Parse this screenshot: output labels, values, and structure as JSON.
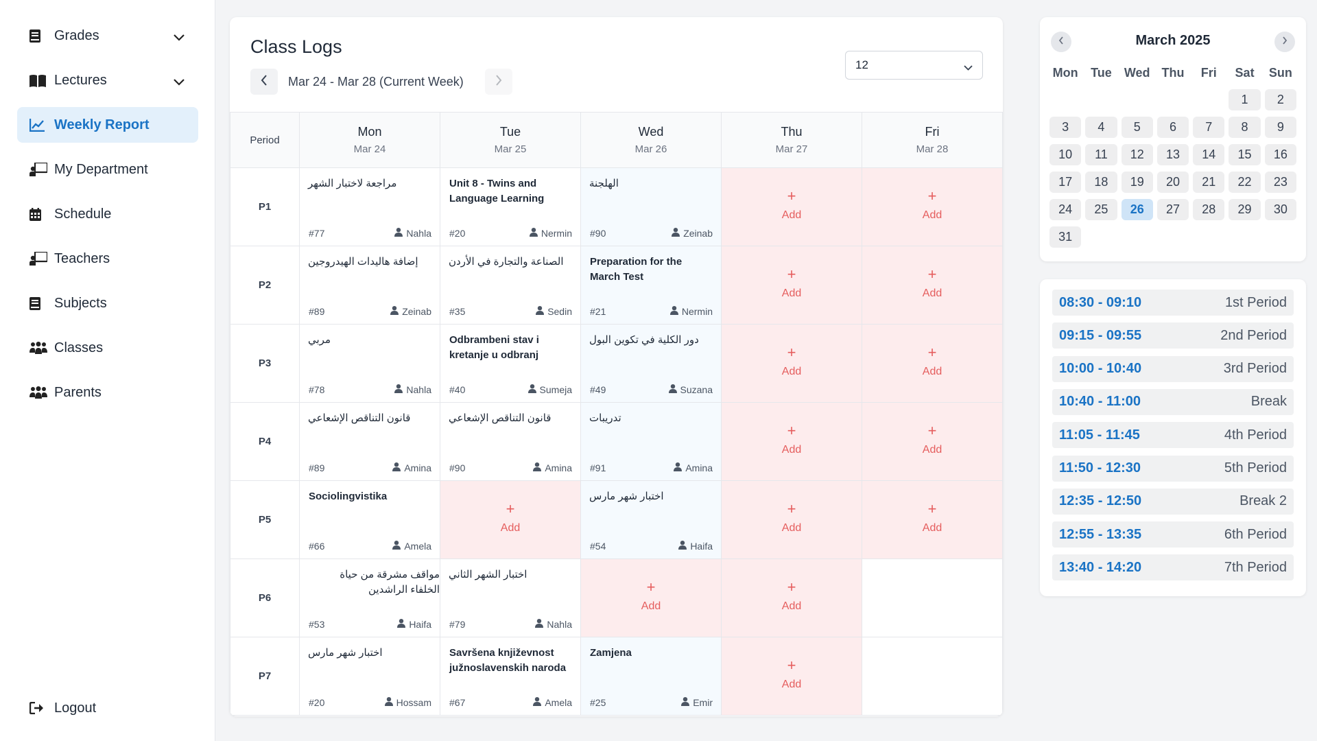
{
  "sidebar": {
    "items": [
      {
        "label": "Grades",
        "icon": "book-icon"
      },
      {
        "label": "Lectures",
        "icon": "open-book-icon"
      },
      {
        "label": "Weekly Report",
        "icon": "chart-line-icon"
      },
      {
        "label": "My Department",
        "icon": "chalkboard-teacher-icon"
      },
      {
        "label": "Schedule",
        "icon": "calendar-icon"
      },
      {
        "label": "Teachers",
        "icon": "chalkboard-teacher-icon"
      },
      {
        "label": "Subjects",
        "icon": "book-icon"
      },
      {
        "label": "Classes",
        "icon": "users-icon"
      },
      {
        "label": "Parents",
        "icon": "users-icon"
      }
    ],
    "logout": "Logout"
  },
  "main": {
    "title": "Class Logs",
    "week_label": "Mar 24 - Mar 28 (Current Week)",
    "class_select": "12",
    "period_header": "Period",
    "add_label": "Add",
    "add_plus": "+",
    "days": [
      {
        "name": "Mon",
        "date": "Mar 24"
      },
      {
        "name": "Tue",
        "date": "Mar 25"
      },
      {
        "name": "Wed",
        "date": "Mar 26"
      },
      {
        "name": "Thu",
        "date": "Mar 27"
      },
      {
        "name": "Fri",
        "date": "Mar 28"
      }
    ],
    "rows": [
      {
        "period": "P1",
        "cells": [
          {
            "topic": "مراجعة لاختبار الشهر",
            "num": "#77",
            "teacher": "Nahla"
          },
          {
            "topic": "Unit 8 - Twins and Language Learning",
            "num": "#20",
            "teacher": "Nermin"
          },
          {
            "topic": "الهلجنة",
            "num": "#90",
            "teacher": "Zeinab"
          }
        ]
      },
      {
        "period": "P2",
        "cells": [
          {
            "topic": "إضافة هاليدات الهيدروجين",
            "num": "#89",
            "teacher": "Zeinab"
          },
          {
            "topic": "الصناعة والتجارة في الأردن",
            "num": "#35",
            "teacher": "Sedin"
          },
          {
            "topic": "Preparation for the March Test",
            "num": "#21",
            "teacher": "Nermin"
          }
        ]
      },
      {
        "period": "P3",
        "cells": [
          {
            "topic": "مربي",
            "num": "#78",
            "teacher": "Nahla"
          },
          {
            "topic": "Odbrambeni stav i kretanje u odbranj",
            "num": "#40",
            "teacher": "Sumeja"
          },
          {
            "topic": "دور الكلية في تكوين البول",
            "num": "#49",
            "teacher": "Suzana"
          }
        ]
      },
      {
        "period": "P4",
        "cells": [
          {
            "topic": "قانون التناقص الإشعاعي",
            "num": "#89",
            "teacher": "Amina"
          },
          {
            "topic": "قانون التناقص الإشعاعي",
            "num": "#90",
            "teacher": "Amina"
          },
          {
            "topic": "تدريبات",
            "num": "#91",
            "teacher": "Amina"
          }
        ]
      },
      {
        "period": "P5",
        "cells": [
          {
            "topic": "Sociolingvistika",
            "num": "#66",
            "teacher": "Amela"
          },
          {
            "topic": "اختبار شهر مارس",
            "num": "#54",
            "teacher": "Haifa"
          }
        ]
      },
      {
        "period": "P6",
        "cells": [
          {
            "topic": "مواقف مشرقة من حياة الخلفاء الراشدين",
            "num": "#53",
            "teacher": "Haifa"
          },
          {
            "topic": "اختبار الشهر الثاني",
            "num": "#79",
            "teacher": "Nahla"
          }
        ]
      },
      {
        "period": "P7",
        "cells": [
          {
            "topic": "اختبار شهر مارس",
            "num": "#20",
            "teacher": "Hossam"
          },
          {
            "topic": "Savršena književnost južnoslavenskih naroda",
            "num": "#67",
            "teacher": "Amela"
          },
          {
            "topic": "Zamjena",
            "num": "#25",
            "teacher": "Emir"
          }
        ]
      }
    ]
  },
  "calendar": {
    "title": "March 2025",
    "weekdays": [
      "Mon",
      "Tue",
      "Wed",
      "Thu",
      "Fri",
      "Sat",
      "Sun"
    ],
    "leading_blanks": 5,
    "days_in_month": 31,
    "today": 26
  },
  "timetable": [
    {
      "time": "08:30 - 09:10",
      "name": "1st Period"
    },
    {
      "time": "09:15 - 09:55",
      "name": "2nd Period"
    },
    {
      "time": "10:00 - 10:40",
      "name": "3rd Period"
    },
    {
      "time": "10:40 - 11:00",
      "name": "Break"
    },
    {
      "time": "11:05 - 11:45",
      "name": "4th Period"
    },
    {
      "time": "11:50 - 12:30",
      "name": "5th Period"
    },
    {
      "time": "12:35 - 12:50",
      "name": "Break 2"
    },
    {
      "time": "12:55 - 13:35",
      "name": "6th Period"
    },
    {
      "time": "13:40 - 14:20",
      "name": "7th Period"
    }
  ],
  "colors": {
    "accent": "#1a73c5",
    "active_nav_bg": "#e3f0fb",
    "empty_cell_bg": "#fdeced",
    "add_text": "#e55d5d"
  }
}
